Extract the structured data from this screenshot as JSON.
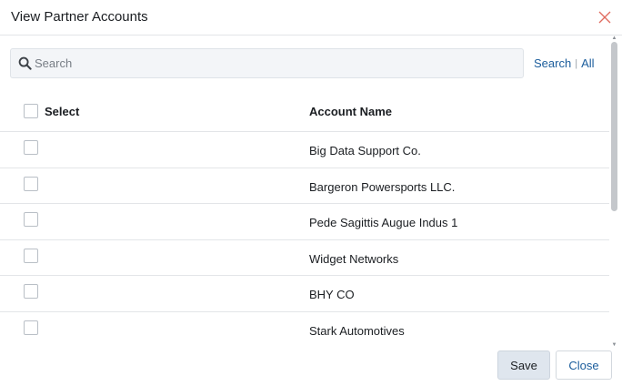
{
  "dialog": {
    "title": "View Partner Accounts"
  },
  "search": {
    "placeholder": "Search",
    "value": "",
    "search_link": "Search",
    "separator": "|",
    "all_link": "All"
  },
  "table": {
    "columns": {
      "select": "Select",
      "account_name": "Account Name"
    },
    "rows": [
      {
        "name": "Big Data Support Co."
      },
      {
        "name": "Bargeron Powersports LLC."
      },
      {
        "name": "Pede Sagittis Augue Indus 1"
      },
      {
        "name": "Widget Networks"
      },
      {
        "name": "BHY CO"
      },
      {
        "name": "Stark Automotives"
      }
    ]
  },
  "footer": {
    "save_label": "Save",
    "close_label": "Close"
  },
  "colors": {
    "link": "#1b5d9c",
    "close_x": "#e06b5f",
    "save_bg": "#dfe6ee"
  }
}
